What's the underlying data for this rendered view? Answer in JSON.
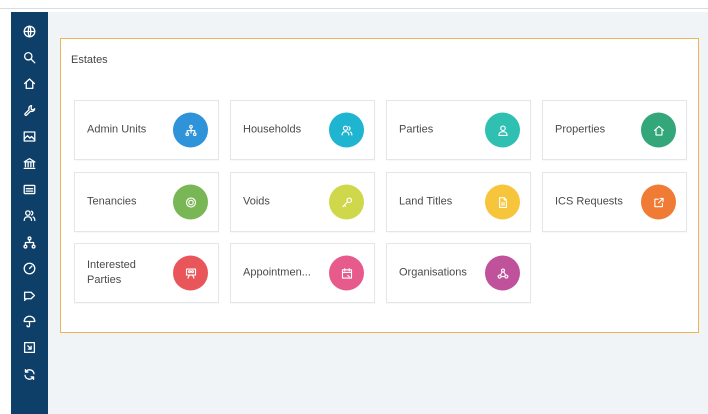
{
  "panel": {
    "title": "Estates"
  },
  "sidebar": {
    "items": [
      {
        "icon": "globe-icon"
      },
      {
        "icon": "search-icon"
      },
      {
        "icon": "home-icon"
      },
      {
        "icon": "wrench-icon"
      },
      {
        "icon": "image-icon"
      },
      {
        "icon": "bank-icon"
      },
      {
        "icon": "card-icon"
      },
      {
        "icon": "users-icon"
      },
      {
        "icon": "hierarchy-icon"
      },
      {
        "icon": "gauge-icon"
      },
      {
        "icon": "tag-icon"
      },
      {
        "icon": "umbrella-icon"
      },
      {
        "icon": "export-icon"
      },
      {
        "icon": "refresh-icon"
      }
    ]
  },
  "tiles": [
    {
      "label": "Admin Units",
      "color": "#2f93d9",
      "icon": "hierarchy-icon"
    },
    {
      "label": "Households",
      "color": "#1fb4cf",
      "icon": "users-icon"
    },
    {
      "label": "Parties",
      "color": "#2fc0b2",
      "icon": "user-icon"
    },
    {
      "label": "Properties",
      "color": "#33a77a",
      "icon": "home-icon"
    },
    {
      "label": "Tenancies",
      "color": "#79b655",
      "icon": "target-icon"
    },
    {
      "label": "Voids",
      "color": "#cfd84a",
      "icon": "key-icon"
    },
    {
      "label": "Land Titles",
      "color": "#f6c53b",
      "icon": "document-icon"
    },
    {
      "label": "ICS Requests",
      "color": "#ef7b34",
      "icon": "external-link-icon"
    },
    {
      "label": "Interested Parties",
      "color": "#e9565a",
      "icon": "people-board-icon"
    },
    {
      "label": "Appointmen...",
      "color": "#e65b8b",
      "icon": "calendar-icon"
    },
    {
      "label": "Organisations",
      "color": "#c0529c",
      "icon": "org-icon"
    }
  ]
}
